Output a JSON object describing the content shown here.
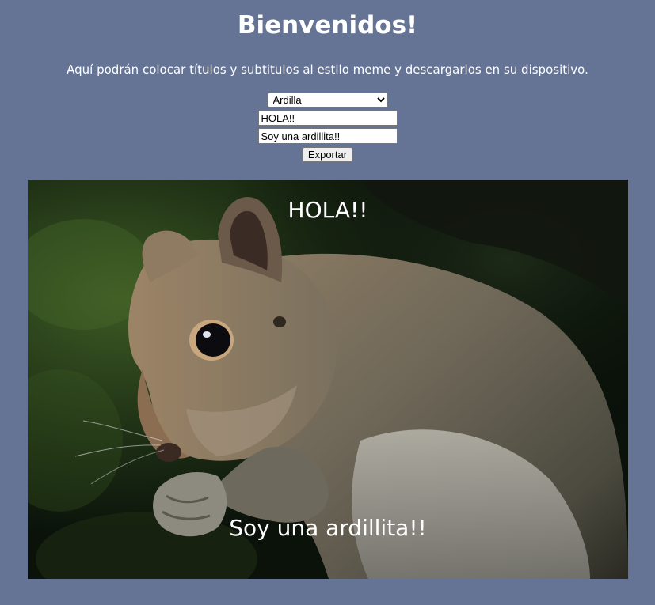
{
  "header": {
    "title": "Bienvenidos!",
    "description": "Aquí podrán colocar títulos y subtitulos al estilo meme y descargarlos en su dispositivo."
  },
  "form": {
    "image_select": {
      "selected": "Ardilla",
      "options": [
        "Ardilla"
      ]
    },
    "top_text_value": "HOLA!!",
    "bottom_text_value": "Soy una ardillita!!",
    "export_label": "Exportar"
  },
  "meme": {
    "top_caption": "HOLA!!",
    "bottom_caption": "Soy una ardillita!!",
    "image_subject": "squirrel-photo"
  },
  "colors": {
    "page_background": "#657495",
    "text": "#ffffff"
  }
}
